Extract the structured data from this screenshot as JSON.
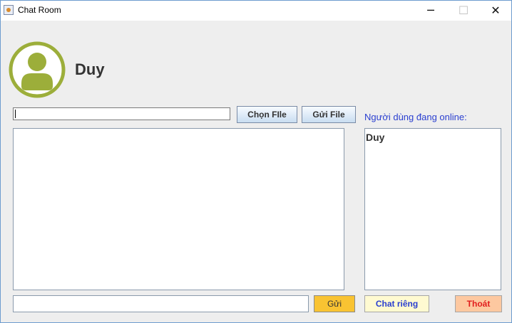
{
  "window": {
    "title": "Chat Room",
    "minimize_glyph": "─",
    "maximize_glyph": "☐",
    "close_glyph": "✕"
  },
  "user": {
    "name": "Duy",
    "avatar_icon": "user-avatar-icon",
    "avatar_color": "#9cae3a"
  },
  "file": {
    "path_value": "",
    "choose_label": "Chọn FIle",
    "send_label": "Gửi File"
  },
  "online": {
    "label": "Người dùng đang online:",
    "users": [
      "Duy"
    ]
  },
  "chat": {
    "messages": [],
    "input_value": "",
    "send_label": "Gửi"
  },
  "actions": {
    "private_chat_label": "Chat riêng",
    "exit_label": "Thoát"
  },
  "colors": {
    "accent_blue": "#2a3fd0",
    "send_button": "#f9c332",
    "private_button": "#fffad1",
    "exit_button": "#fdc8a0",
    "exit_text": "#e11d1d"
  }
}
